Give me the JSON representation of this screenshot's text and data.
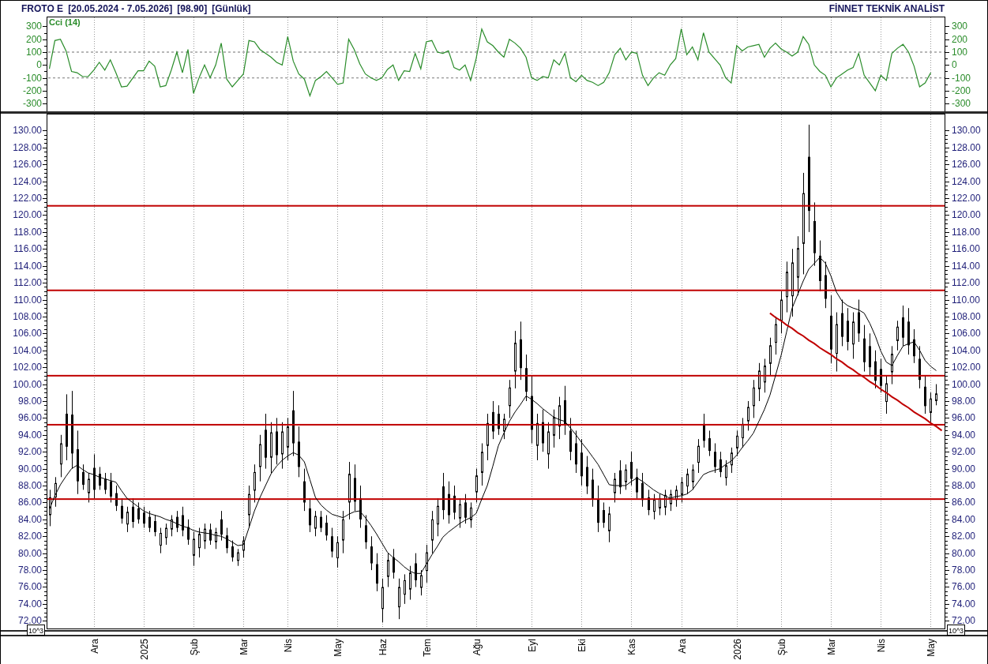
{
  "header": {
    "symbol": "FROTO E",
    "date_range": "[20.05.2024 - 7.05.2026]",
    "last_price": "[98.90]",
    "period": "[Günlük]",
    "brand": "FİNNET TEKNİK ANALİST"
  },
  "indicator_panel": {
    "right_axis_labels": [
      "300",
      "200",
      "100",
      "0",
      "-100",
      "-200",
      "-300"
    ],
    "chart_data": {
      "type": "line",
      "ylim": [
        -360,
        376
      ],
      "yticks": [
        300,
        200,
        100,
        0,
        -100,
        -200,
        -300
      ],
      "categories": [
        null,
        null,
        null,
        null,
        null,
        null,
        null,
        null,
        null,
        null,
        null,
        null,
        null,
        null,
        null,
        null,
        null,
        null,
        null,
        null,
        null,
        null,
        null,
        null,
        null,
        null,
        null,
        null,
        null,
        null,
        null,
        null,
        null,
        null,
        null,
        null,
        null,
        null,
        null,
        null,
        null,
        null,
        null,
        null,
        null,
        null,
        null,
        null,
        null,
        null,
        null,
        null,
        null,
        null,
        null,
        null,
        null,
        null,
        null,
        null,
        null,
        null,
        null,
        null,
        null,
        null,
        null,
        null,
        null,
        null,
        null,
        null,
        null,
        null,
        null,
        null,
        null,
        null,
        null,
        null,
        null,
        null,
        null,
        null,
        null,
        null,
        null,
        null,
        null,
        null,
        null,
        null,
        null,
        null,
        null,
        null,
        null,
        null,
        null,
        null,
        null,
        null,
        null,
        null,
        null,
        null,
        null,
        null,
        null,
        null,
        null,
        null,
        null,
        null,
        null,
        null,
        null,
        null,
        null,
        null,
        null,
        null,
        null,
        null,
        null,
        null,
        null,
        null,
        null,
        null,
        null,
        null,
        null,
        null,
        null,
        null,
        null,
        null,
        null,
        null,
        null,
        null,
        null,
        null,
        null,
        null,
        null,
        null,
        null,
        null,
        null,
        null,
        null,
        null,
        null,
        null,
        null,
        null,
        null,
        null,
        null,
        null
      ],
      "series": [
        {
          "name": "Cci (14)",
          "color": "#2a8c2a",
          "values": [
            -30,
            190,
            200,
            110,
            -50,
            -60,
            -90,
            -90,
            -40,
            20,
            -40,
            40,
            -60,
            -170,
            -165,
            -105,
            -45,
            -45,
            30,
            -10,
            -170,
            -160,
            -40,
            100,
            -60,
            120,
            -220,
            -100,
            0,
            -100,
            0,
            170,
            -110,
            -170,
            -120,
            -70,
            190,
            180,
            120,
            90,
            60,
            20,
            0,
            220,
            30,
            -70,
            -110,
            -240,
            -120,
            -90,
            -50,
            -100,
            -150,
            -140,
            200,
            120,
            10,
            -70,
            -100,
            -120,
            -100,
            -35,
            0,
            -120,
            -45,
            -50,
            90,
            -30,
            180,
            190,
            100,
            90,
            110,
            -20,
            -40,
            0,
            -120,
            50,
            280,
            180,
            150,
            100,
            60,
            200,
            170,
            130,
            60,
            -100,
            -120,
            -90,
            -100,
            40,
            0,
            90,
            -100,
            -130,
            -80,
            -120,
            -135,
            -160,
            -135,
            -60,
            80,
            130,
            40,
            100,
            90,
            -80,
            -160,
            -100,
            -60,
            -80,
            0,
            50,
            280,
            80,
            140,
            40,
            250,
            100,
            50,
            0,
            -100,
            -140,
            150,
            110,
            140,
            150,
            160,
            60,
            130,
            170,
            125,
            100,
            70,
            100,
            220,
            160,
            0,
            -50,
            -80,
            -170,
            -100,
            -70,
            -40,
            -20,
            90,
            -80,
            -140,
            -200,
            -80,
            -120,
            90,
            130,
            160,
            100,
            -10,
            -170,
            -140,
            -60,
            null,
            null
          ]
        }
      ],
      "ref_lines": [
        {
          "axis": "y",
          "value": 100
        },
        {
          "axis": "y",
          "value": -100
        }
      ]
    }
  },
  "price_panel": {
    "scale_labels": [
      "10^3",
      "10^3"
    ],
    "chart_data": {
      "type": "candlestick",
      "ylim": [
        71,
        132
      ],
      "categories": [
        null,
        null,
        null,
        null,
        null,
        null,
        null,
        null,
        "Ara",
        null,
        null,
        null,
        null,
        null,
        null,
        null,
        null,
        "2025",
        null,
        null,
        null,
        null,
        null,
        null,
        null,
        null,
        "Şub",
        null,
        null,
        null,
        null,
        null,
        null,
        null,
        null,
        "Mar",
        null,
        null,
        null,
        null,
        null,
        null,
        null,
        "Nis",
        null,
        null,
        null,
        null,
        null,
        null,
        null,
        null,
        "May",
        null,
        null,
        null,
        null,
        null,
        null,
        null,
        "Haz",
        null,
        null,
        null,
        null,
        null,
        null,
        null,
        "Tem",
        null,
        null,
        null,
        null,
        null,
        null,
        null,
        null,
        "Ağu",
        null,
        null,
        null,
        null,
        null,
        null,
        null,
        null,
        null,
        "Eyl",
        null,
        null,
        null,
        null,
        null,
        null,
        null,
        null,
        "Eki",
        null,
        null,
        null,
        null,
        null,
        null,
        null,
        null,
        "Kas",
        null,
        null,
        null,
        null,
        null,
        null,
        null,
        null,
        "Ara",
        null,
        null,
        null,
        null,
        null,
        null,
        null,
        null,
        null,
        "2026",
        null,
        null,
        null,
        null,
        null,
        null,
        null,
        "Şub",
        null,
        null,
        null,
        null,
        null,
        null,
        null,
        null,
        "Mar",
        null,
        null,
        null,
        null,
        null,
        null,
        null,
        null,
        "Nis",
        null,
        null,
        null,
        null,
        null,
        null,
        null,
        null,
        "May",
        null,
        null
      ],
      "yticks": [
        {
          "value": 130,
          "label": "130.00"
        },
        {
          "value": 128,
          "label": "128.00"
        },
        {
          "value": 126,
          "label": "126.00"
        },
        {
          "value": 124,
          "label": "124.00"
        },
        {
          "value": 122,
          "label": "122.00"
        },
        {
          "value": 120,
          "label": "120.00"
        },
        {
          "value": 118,
          "label": "118.00"
        },
        {
          "value": 116,
          "label": "116.00"
        },
        {
          "value": 114,
          "label": "114.00"
        },
        {
          "value": 112,
          "label": "112.00"
        },
        {
          "value": 110,
          "label": "110.00"
        },
        {
          "value": 108,
          "label": "108.00"
        },
        {
          "value": 106,
          "label": "106.00"
        },
        {
          "value": 104,
          "label": "104.00"
        },
        {
          "value": 102,
          "label": "102.00"
        },
        {
          "value": 100,
          "label": "100.00"
        },
        {
          "value": 98,
          "label": "98.00"
        },
        {
          "value": 96,
          "label": "96.00"
        },
        {
          "value": 94,
          "label": "94.00"
        },
        {
          "value": 92,
          "label": "92.00"
        },
        {
          "value": 90,
          "label": "90.00"
        },
        {
          "value": 88,
          "label": "88.00"
        },
        {
          "value": 86,
          "label": "86.00"
        },
        {
          "value": 84,
          "label": "84.00"
        },
        {
          "value": 82,
          "label": "82.00"
        },
        {
          "value": 80,
          "label": "80.00"
        },
        {
          "value": 78,
          "label": "78.00"
        },
        {
          "value": 76,
          "label": "76.00"
        },
        {
          "value": 74,
          "label": "74.00"
        },
        {
          "value": 72,
          "label": "72.00"
        }
      ],
      "ohlc": [
        [
          84.5,
          87.5,
          83.2,
          86.6
        ],
        [
          86.6,
          89,
          85.5,
          88.3
        ],
        [
          90.5,
          94,
          89,
          93
        ],
        [
          96.5,
          98.8,
          91,
          92.6
        ],
        [
          96.4,
          99.2,
          90,
          91.8
        ],
        [
          92.3,
          94.5,
          87,
          88.5
        ],
        [
          89.6,
          90.5,
          87.5,
          88.1
        ],
        [
          87.1,
          89.5,
          86,
          88.8
        ],
        [
          90.1,
          91.7,
          86.5,
          87.5
        ],
        [
          89.4,
          90.2,
          87.5,
          88
        ],
        [
          88.8,
          89.5,
          87,
          87.5
        ],
        [
          88.5,
          89.5,
          86,
          86.7
        ],
        [
          87.1,
          88,
          85,
          85.6
        ],
        [
          85.6,
          86.5,
          83.5,
          84.1
        ],
        [
          83.4,
          85.5,
          82.5,
          84.9
        ],
        [
          85.5,
          86.5,
          83,
          83.7
        ],
        [
          85.3,
          86,
          83.5,
          84
        ],
        [
          84.8,
          85.5,
          83,
          83.5
        ],
        [
          84.3,
          85,
          82.5,
          83
        ],
        [
          83.8,
          84.5,
          82,
          82.5
        ],
        [
          80.9,
          83,
          80,
          82.4
        ],
        [
          81.8,
          83.5,
          81,
          83
        ],
        [
          82.8,
          84.5,
          82,
          84
        ],
        [
          84.3,
          85,
          82.5,
          83
        ],
        [
          84.5,
          85.5,
          82,
          82.7
        ],
        [
          83.1,
          84,
          81,
          81.6
        ],
        [
          79.7,
          82.5,
          78.5,
          81.7
        ],
        [
          80.6,
          83,
          79.5,
          82.3
        ],
        [
          81.4,
          83.5,
          80.5,
          82.9
        ],
        [
          82.8,
          83.5,
          81,
          81.5
        ],
        [
          81.3,
          83,
          80.5,
          82.5
        ],
        [
          84,
          85,
          81.5,
          82.2
        ],
        [
          82.1,
          83,
          80,
          80.6
        ],
        [
          80.8,
          81.5,
          79,
          79.5
        ],
        [
          79.1,
          80.5,
          78.5,
          80.1
        ],
        [
          80.3,
          82,
          79.5,
          81.5
        ],
        [
          84.5,
          88,
          83,
          87
        ],
        [
          87.4,
          90.5,
          86,
          89.6
        ],
        [
          90.2,
          94,
          88.5,
          92.9
        ],
        [
          94.6,
          96.5,
          90,
          91.3
        ],
        [
          91.3,
          95.5,
          89.5,
          94.3
        ],
        [
          94.4,
          96,
          90.5,
          91.6
        ],
        [
          91.7,
          95.5,
          90,
          94.4
        ],
        [
          92.5,
          96,
          91,
          95
        ],
        [
          96.9,
          99.2,
          91.5,
          93
        ],
        [
          93.2,
          95,
          89,
          90.2
        ],
        [
          88.5,
          90,
          85,
          86
        ],
        [
          85.3,
          86.5,
          82.5,
          83.3
        ],
        [
          82.9,
          85,
          82,
          84.4
        ],
        [
          84.3,
          85,
          82.5,
          83
        ],
        [
          83.6,
          84.5,
          81.5,
          82.1
        ],
        [
          82,
          83,
          79.5,
          80.2
        ],
        [
          79.4,
          82,
          78.3,
          81.3
        ],
        [
          81.5,
          85,
          80,
          84
        ],
        [
          86,
          90.8,
          84,
          89.4
        ],
        [
          88.9,
          90.5,
          85,
          86.1
        ],
        [
          86.5,
          88,
          83,
          84
        ],
        [
          83.3,
          84.5,
          80.5,
          81.3
        ],
        [
          80.8,
          82,
          78,
          78.8
        ],
        [
          78.7,
          80,
          75.5,
          76.4
        ],
        [
          73.4,
          77,
          71.8,
          76
        ],
        [
          77.2,
          80,
          76,
          79.2
        ],
        [
          79.5,
          80.5,
          77,
          77.7
        ],
        [
          73.6,
          77,
          72.2,
          76
        ],
        [
          75.1,
          77.5,
          74,
          76.8
        ],
        [
          75.7,
          78.5,
          74.5,
          77.7
        ],
        [
          78.8,
          80,
          76,
          76.8
        ],
        [
          75.9,
          78,
          75,
          77.4
        ],
        [
          77.9,
          81,
          76.5,
          80.1
        ],
        [
          81.5,
          85,
          80,
          84
        ],
        [
          83.4,
          86.5,
          82,
          85.6
        ],
        [
          87.9,
          89.5,
          84,
          85.1
        ],
        [
          87,
          88.5,
          83.5,
          84.5
        ],
        [
          86.8,
          88,
          84,
          84.8
        ],
        [
          84.1,
          86.5,
          83,
          85.8
        ],
        [
          86,
          87,
          83.5,
          84.2
        ],
        [
          83.9,
          86,
          83,
          85.4
        ],
        [
          87.2,
          90,
          86,
          89.2
        ],
        [
          89.5,
          93,
          88,
          92
        ],
        [
          92.7,
          96.5,
          91,
          95.4
        ],
        [
          96.7,
          98,
          93.5,
          94.4
        ],
        [
          96.5,
          97.5,
          94,
          94.7
        ],
        [
          94.4,
          96.5,
          93.5,
          95.9
        ],
        [
          97.4,
          100.5,
          96,
          99.6
        ],
        [
          101.5,
          106.3,
          99.5,
          104.9
        ],
        [
          105.3,
          107.4,
          100.5,
          101.9
        ],
        [
          101.9,
          103.5,
          98,
          99.1
        ],
        [
          98.6,
          101,
          93,
          94.6
        ],
        [
          92.7,
          96.5,
          91,
          95.4
        ],
        [
          95.5,
          97,
          92,
          93
        ],
        [
          91.7,
          95.5,
          90,
          94.4
        ],
        [
          93.9,
          97,
          92.5,
          96.1
        ],
        [
          95,
          98.5,
          93.5,
          97.5
        ],
        [
          98.1,
          99.8,
          94,
          95.2
        ],
        [
          94.5,
          96,
          91,
          92
        ],
        [
          93,
          94.5,
          89.5,
          90.5
        ],
        [
          91.9,
          93.5,
          88,
          89.1
        ],
        [
          90.2,
          91.5,
          87,
          87.9
        ],
        [
          88.7,
          90,
          85.5,
          86.4
        ],
        [
          86.4,
          88,
          82.5,
          83.6
        ],
        [
          85.1,
          86,
          83,
          83.6
        ],
        [
          82.6,
          85.5,
          81.3,
          84.7
        ],
        [
          87.1,
          89.5,
          86,
          88.8
        ],
        [
          89.8,
          91,
          87,
          87.8
        ],
        [
          88.4,
          90.5,
          87.5,
          89.9
        ],
        [
          90.8,
          92,
          88,
          88.8
        ],
        [
          89,
          90,
          86.5,
          87.2
        ],
        [
          88.3,
          89.5,
          85.5,
          86.3
        ],
        [
          86.6,
          87.5,
          84.5,
          85.1
        ],
        [
          84.9,
          87,
          84,
          86.4
        ],
        [
          85.3,
          87,
          84.5,
          86.5
        ],
        [
          85.4,
          87.5,
          84.5,
          86.9
        ],
        [
          85.8,
          87.5,
          85,
          87
        ],
        [
          86.3,
          88,
          85.5,
          87.5
        ],
        [
          86.9,
          89,
          86,
          88.4
        ],
        [
          87.9,
          90,
          87,
          89.4
        ],
        [
          88.4,
          90.5,
          87.5,
          89.9
        ],
        [
          90.7,
          93.5,
          89.5,
          92.7
        ],
        [
          95.3,
          96.5,
          92.5,
          93.3
        ],
        [
          93.6,
          94.5,
          91.5,
          92.1
        ],
        [
          92,
          93,
          89.5,
          90.2
        ],
        [
          91.1,
          92,
          89,
          89.6
        ],
        [
          88.9,
          91,
          88,
          90.4
        ],
        [
          90.4,
          92.5,
          89.5,
          91.9
        ],
        [
          92.4,
          94.5,
          91.5,
          93.9
        ],
        [
          93.6,
          96,
          92.5,
          95.3
        ],
        [
          95.6,
          98,
          94.5,
          97.3
        ],
        [
          97.4,
          100.5,
          96,
          99.6
        ],
        [
          99.4,
          102.5,
          98,
          101.6
        ],
        [
          100.2,
          103,
          99,
          102.2
        ],
        [
          102.4,
          105.5,
          101,
          104.6
        ],
        [
          104.9,
          108,
          103.5,
          107.1
        ],
        [
          107.5,
          111,
          106,
          110
        ],
        [
          110.3,
          114.5,
          108.5,
          113.3
        ],
        [
          110.4,
          116,
          108,
          114.4
        ],
        [
          112.6,
          117.5,
          110.5,
          116.1
        ],
        [
          116.6,
          125,
          113,
          122.6
        ],
        [
          126.9,
          130.7,
          118,
          120.5
        ],
        [
          119.3,
          121.5,
          114,
          115.5
        ],
        [
          115.2,
          117,
          111,
          112.2
        ],
        [
          112.9,
          114.5,
          109,
          110.1
        ],
        [
          108.1,
          110.5,
          102.5,
          104.1
        ],
        [
          103.6,
          108.5,
          101.5,
          107.1
        ],
        [
          108.4,
          110,
          104.5,
          105.6
        ],
        [
          107.5,
          109,
          104,
          105
        ],
        [
          104.7,
          108.5,
          103,
          107.4
        ],
        [
          108.5,
          110,
          105,
          106
        ],
        [
          105.4,
          107,
          101.5,
          102.6
        ],
        [
          104.5,
          106,
          101,
          102
        ],
        [
          102.7,
          104,
          99.5,
          100.4
        ],
        [
          101.8,
          103,
          99,
          99.8
        ],
        [
          97.9,
          101,
          96.5,
          100.1
        ],
        [
          101.4,
          104.5,
          100,
          103.6
        ],
        [
          105.1,
          107.5,
          104,
          106.8
        ],
        [
          107.9,
          109.3,
          104.5,
          105.5
        ],
        [
          107.4,
          109,
          103.5,
          104.6
        ],
        [
          105.3,
          106.5,
          102.5,
          103.3
        ],
        [
          103,
          104.5,
          99.5,
          100.5
        ],
        [
          99.7,
          101,
          96.5,
          97.4
        ],
        [
          96.6,
          99,
          95.5,
          98.3
        ],
        [
          98,
          100,
          97.5,
          98.9
        ],
        null
      ],
      "ref_lines": [
        {
          "axis": "y",
          "value": 121.1
        },
        {
          "axis": "y",
          "value": 111.1
        },
        {
          "axis": "y",
          "value": 101
        },
        {
          "axis": "y",
          "value": 95.2
        },
        {
          "axis": "y",
          "value": 86.4
        }
      ]
    },
    "overlay_lines": {
      "chart_data": {
        "type": "line",
        "ylim": [
          71,
          132
        ],
        "series": [
          {
            "color": "#000000",
            "values": [
              85.2,
              86.8,
              88.1,
              89.1,
              90,
              90.4,
              89.9,
              89.5,
              89.3,
              89,
              88.8,
              88.6,
              88.4,
              87.4,
              86.5,
              86,
              85.5,
              85,
              84.7,
              84.5,
              84.3,
              84,
              83.8,
              83.5,
              83.2,
              83,
              82.7,
              82.5,
              82.4,
              82.3,
              82.1,
              82,
              81.7,
              81.3,
              80.9,
              81,
              83,
              85,
              86.6,
              88,
              89.4,
              90.3,
              91,
              91.5,
              91.9,
              91.6,
              90.8,
              88.7,
              86.6,
              85.7,
              85.1,
              84.6,
              84.4,
              84.2,
              84.6,
              84.9,
              85,
              84.2,
              83.3,
              82.3,
              81.2,
              80.1,
              79.5,
              79,
              78.4,
              77.9,
              77.6,
              77.6,
              78.7,
              79.8,
              80.8,
              81.9,
              82.5,
              83,
              83.5,
              83.9,
              84.2,
              84.7,
              86.4,
              88,
              90.3,
              92.7,
              94.2,
              95.6,
              96.7,
              97.6,
              98.6,
              98.2,
              97.7,
              97.1,
              96.6,
              96.1,
              95.8,
              95.6,
              94.8,
              94,
              93.1,
              92.3,
              91.4,
              90.5,
              89.3,
              88.1,
              88,
              88,
              88,
              88.5,
              88.9,
              88.5,
              88,
              87.5,
              87.1,
              86.8,
              86.5,
              86.7,
              86.8,
              87,
              87.5,
              88.4,
              89.3,
              89.6,
              89.8,
              90,
              90.5,
              90.9,
              91.6,
              92.5,
              93.3,
              94.2,
              95.6,
              97,
              98.7,
              101,
              103.4,
              106.2,
              109,
              110.6,
              112.2,
              113.6,
              114.3,
              115,
              114.3,
              112.8,
              110.9,
              109.8,
              109.3,
              109,
              108.8,
              108.4,
              107.2,
              105.7,
              103.9,
              102.6,
              102.2,
              103.4,
              104.5,
              104.8,
              105,
              104,
              102.8,
              102.1,
              101.6,
              null
            ]
          },
          {
            "color": "#c00000",
            "values": [
              null,
              null,
              null,
              null,
              null,
              null,
              null,
              null,
              null,
              null,
              null,
              null,
              null,
              null,
              null,
              null,
              null,
              null,
              null,
              null,
              null,
              null,
              null,
              null,
              null,
              null,
              null,
              null,
              null,
              null,
              null,
              null,
              null,
              null,
              null,
              null,
              null,
              null,
              null,
              null,
              null,
              null,
              null,
              null,
              null,
              null,
              null,
              null,
              null,
              null,
              null,
              null,
              null,
              null,
              null,
              null,
              null,
              null,
              null,
              null,
              null,
              null,
              null,
              null,
              null,
              null,
              null,
              null,
              null,
              null,
              null,
              null,
              null,
              null,
              null,
              null,
              null,
              null,
              null,
              null,
              null,
              null,
              null,
              null,
              null,
              null,
              null,
              null,
              null,
              null,
              null,
              null,
              null,
              null,
              null,
              null,
              null,
              null,
              null,
              null,
              null,
              null,
              null,
              null,
              null,
              null,
              null,
              null,
              null,
              null,
              null,
              null,
              null,
              null,
              null,
              null,
              null,
              null,
              null,
              null,
              null,
              null,
              null,
              null,
              null,
              null,
              null,
              null,
              null,
              null,
              108.4,
              107.9,
              107.5,
              107,
              106.6,
              106.1,
              105.7,
              105.2,
              104.8,
              104.3,
              103.9,
              103.5,
              103,
              102.6,
              102.1,
              101.7,
              101.2,
              100.8,
              100.3,
              99.9,
              99.4,
              99,
              98.5,
              98.1,
              97.6,
              97.2,
              96.7,
              96.3,
              95.9,
              95.4,
              95,
              94.5
            ]
          }
        ]
      }
    }
  }
}
